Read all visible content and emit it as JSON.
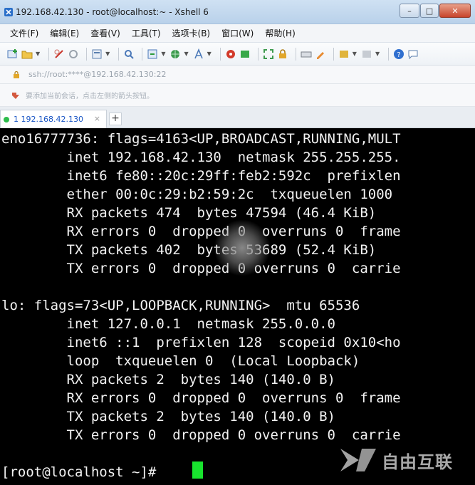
{
  "window": {
    "title": "192.168.42.130 - root@localhost:~ - Xshell 6",
    "minimize_label": "–",
    "maximize_label": "□",
    "close_label": "✕"
  },
  "menu": {
    "items": [
      "文件(F)",
      "编辑(E)",
      "查看(V)",
      "工具(T)",
      "选项卡(B)",
      "窗口(W)",
      "帮助(H)"
    ]
  },
  "toolbar": {
    "icons": [
      "new-session-icon",
      "open-folder-icon",
      "disconnect-icon",
      "reconnect-icon",
      "properties-icon",
      "find-icon",
      "transfer-icon",
      "globe-icon",
      "font-icon",
      "xftp-icon",
      "xmanager-icon",
      "fullscreen-icon",
      "lock-icon",
      "keyboard-icon",
      "highlight-icon",
      "script-icon",
      "layout-icon",
      "help-icon",
      "chat-icon"
    ]
  },
  "address": {
    "value": "ssh://root:****@192.168.42.130:22"
  },
  "hint": {
    "text": "要添加当前会话，点击左侧的箭头按钮。"
  },
  "tabs": [
    {
      "label": "1 192.168.42.130",
      "close": "×"
    }
  ],
  "tab_add_label": "+",
  "terminal": {
    "lines": [
      "eno16777736: flags=4163<UP,BROADCAST,RUNNING,MULT",
      "        inet 192.168.42.130  netmask 255.255.255.",
      "        inet6 fe80::20c:29ff:feb2:592c  prefixlen",
      "        ether 00:0c:29:b2:59:2c  txqueuelen 1000",
      "        RX packets 474  bytes 47594 (46.4 KiB)",
      "        RX errors 0  dropped 0  overruns 0  frame",
      "        TX packets 402  bytes 53689 (52.4 KiB)",
      "        TX errors 0  dropped 0 overruns 0  carrie",
      "",
      "lo: flags=73<UP,LOOPBACK,RUNNING>  mtu 65536",
      "        inet 127.0.0.1  netmask 255.0.0.0",
      "        inet6 ::1  prefixlen 128  scopeid 0x10<ho",
      "        loop  txqueuelen 0  (Local Loopback)",
      "        RX packets 2  bytes 140 (140.0 B)",
      "        RX errors 0  dropped 0  overruns 0  frame",
      "        TX packets 2  bytes 140 (140.0 B)",
      "        TX errors 0  dropped 0 overruns 0  carrie",
      "",
      "[root@localhost ~]# "
    ],
    "cursor_color": "#18e32e",
    "text_color": "#f2f2f2",
    "background": "#000000"
  },
  "watermark": {
    "text": "自由互联"
  }
}
